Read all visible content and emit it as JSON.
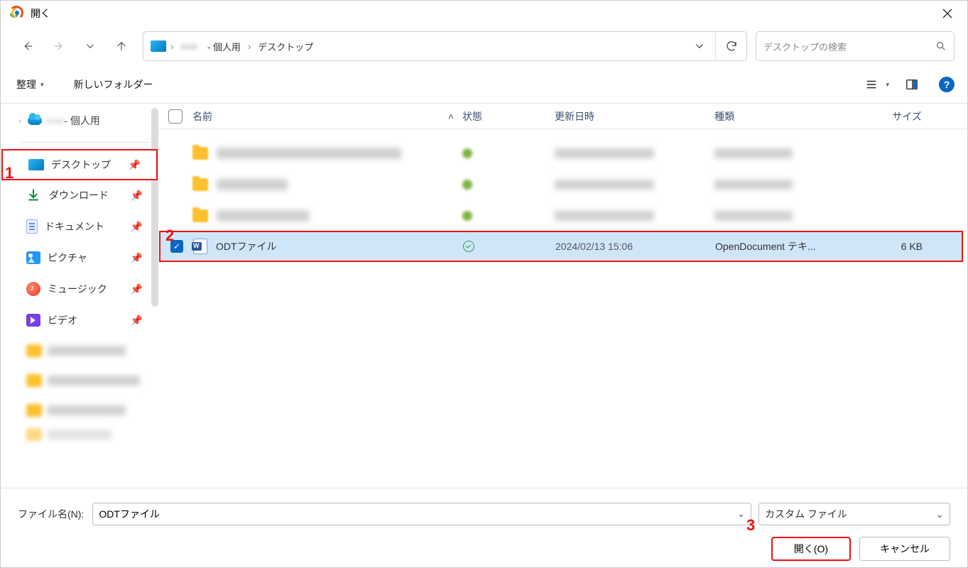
{
  "dialog": {
    "title": "開く"
  },
  "breadcrumb": {
    "parts": [
      "- 個人用",
      "デスクトップ"
    ]
  },
  "search": {
    "placeholder": "デスクトップの検索"
  },
  "toolbar": {
    "organize": "整理",
    "new_folder": "新しいフォルダー"
  },
  "sidebar": {
    "onedrive": "- 個人用",
    "quick": {
      "desktop": "デスクトップ",
      "downloads": "ダウンロード",
      "documents": "ドキュメント",
      "pictures": "ピクチャ",
      "music": "ミュージック",
      "videos": "ビデオ"
    }
  },
  "columns": {
    "name": "名前",
    "state": "状態",
    "date": "更新日時",
    "type": "種類",
    "size": "サイズ"
  },
  "selected_file": {
    "name": "ODTファイル",
    "date": "2024/02/13 15:06",
    "type": "OpenDocument テキ...",
    "size": "6 KB"
  },
  "bottom": {
    "label": "ファイル名(N):",
    "filename": "ODTファイル",
    "filetype": "カスタム ファイル",
    "open": "開く(O)",
    "cancel": "キャンセル"
  },
  "annotations": {
    "a1": "1",
    "a2": "2",
    "a3": "3"
  }
}
